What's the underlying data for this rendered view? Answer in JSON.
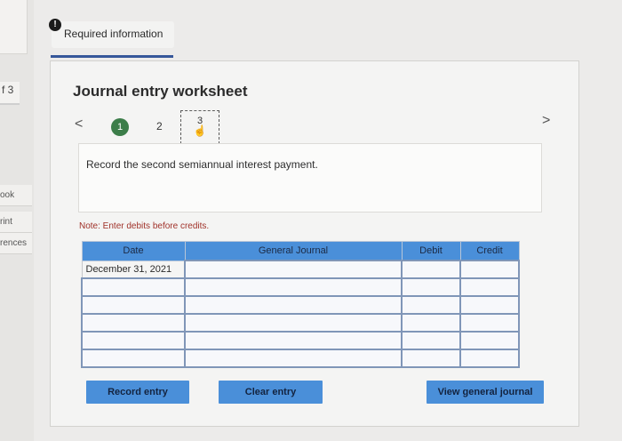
{
  "left_nav": {
    "number_fragment": "f 3",
    "items": [
      "ook",
      "rint",
      "rences"
    ]
  },
  "tab": {
    "badge": "!",
    "label": "Required information"
  },
  "worksheet": {
    "title": "Journal entry worksheet",
    "prev_arrow": "<",
    "next_arrow": ">",
    "steps": [
      {
        "label": "1",
        "state": "completed"
      },
      {
        "label": "2",
        "state": "default"
      },
      {
        "label": "3",
        "state": "active"
      }
    ],
    "instruction": "Record the second semiannual interest payment.",
    "note": "Note: Enter debits before credits."
  },
  "table": {
    "headers": {
      "date": "Date",
      "general_journal": "General Journal",
      "debit": "Debit",
      "credit": "Credit"
    },
    "rows": [
      {
        "date": "December 31, 2021",
        "account": "",
        "debit": "",
        "credit": ""
      },
      {
        "date": "",
        "account": "",
        "debit": "",
        "credit": ""
      },
      {
        "date": "",
        "account": "",
        "debit": "",
        "credit": ""
      },
      {
        "date": "",
        "account": "",
        "debit": "",
        "credit": ""
      },
      {
        "date": "",
        "account": "",
        "debit": "",
        "credit": ""
      },
      {
        "date": "",
        "account": "",
        "debit": "",
        "credit": ""
      }
    ]
  },
  "buttons": {
    "record": "Record entry",
    "clear": "Clear entry",
    "view": "View general journal"
  },
  "colors": {
    "accent": "#4a8fd9",
    "step_complete": "#3c7d49",
    "note": "#a0322a"
  }
}
